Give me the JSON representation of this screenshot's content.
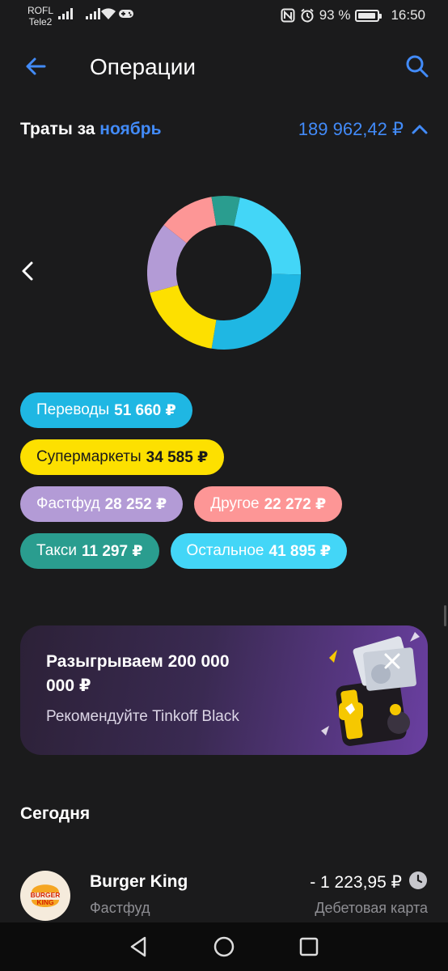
{
  "status_bar": {
    "carrier_line1": "ROFL",
    "carrier_line2": "Tele2",
    "battery": "93 %",
    "time": "16:50"
  },
  "header": {
    "title": "Операции",
    "back_icon": "arrow-left-icon",
    "search_icon": "search-icon"
  },
  "spending": {
    "label": "Траты за",
    "month": "ноябрь",
    "total": "189 962,42 ₽"
  },
  "chart_data": {
    "type": "pie",
    "style": "donut",
    "segments": [
      {
        "name": "Переводы",
        "value": 51660,
        "color": "#1fb7e3"
      },
      {
        "name": "Супермаркеты",
        "value": 34585,
        "color": "#fde000"
      },
      {
        "name": "Фастфуд",
        "value": 28252,
        "color": "#b39bd6"
      },
      {
        "name": "Другое",
        "value": 22272,
        "color": "#fd9696"
      },
      {
        "name": "Такси",
        "value": 11297,
        "color": "#2a9d8f"
      },
      {
        "name": "Остальное",
        "value": 41895,
        "color": "#43d6f7"
      }
    ]
  },
  "chips": [
    {
      "label": "Переводы",
      "amount": "51 660 ₽",
      "color": "#1fb7e3",
      "dark": false
    },
    {
      "label": "Супермаркеты",
      "amount": "34 585 ₽",
      "color": "#fde000",
      "dark": true
    },
    {
      "label": "Фастфуд",
      "amount": "28 252 ₽",
      "color": "#b39bd6",
      "dark": false
    },
    {
      "label": "Другое",
      "amount": "22 272 ₽",
      "color": "#fd9696",
      "dark": false
    },
    {
      "label": "Такси",
      "amount": "11 297 ₽",
      "color": "#2a9d8f",
      "dark": false
    },
    {
      "label": "Остальное",
      "amount": "41 895 ₽",
      "color": "#43d6f7",
      "dark": false
    }
  ],
  "promo": {
    "title": "Разыгрываем 200 000 000 ₽",
    "subtitle": "Рекомендуйте Tinkoff Black"
  },
  "section": {
    "today": "Сегодня"
  },
  "operation": {
    "logo_top": "BURGER",
    "logo_bottom": "KING",
    "name": "Burger King",
    "category": "Фастфуд",
    "amount": "- 1 223,95 ₽",
    "card": "Дебетовая карта",
    "status_icon": "clock-icon"
  },
  "nav": {
    "back_icon": "triangle-back-icon",
    "home_icon": "circle-home-icon",
    "recents_icon": "square-recents-icon"
  }
}
